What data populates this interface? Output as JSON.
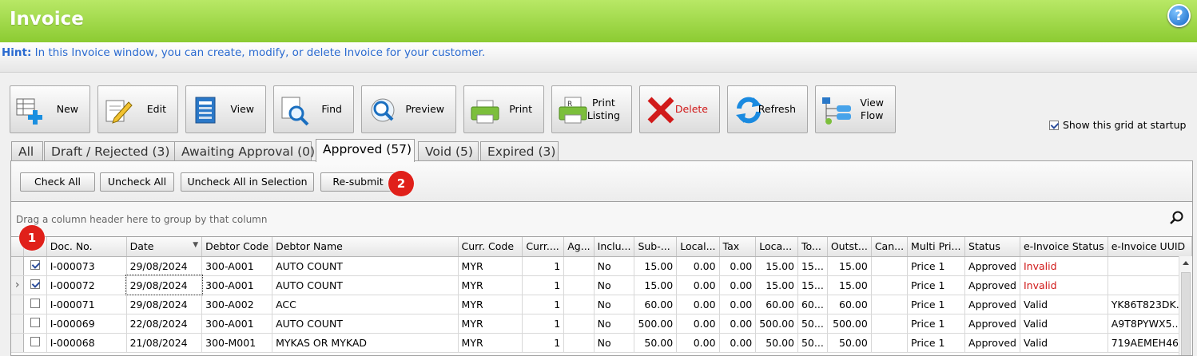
{
  "window": {
    "title": "Invoice",
    "help_label": "?"
  },
  "hint": {
    "label": "Hint:",
    "text": " In this Invoice window, you can create, modify, or delete Invoice for your customer."
  },
  "toolbar": {
    "new": "New",
    "edit": "Edit",
    "view": "View",
    "find": "Find",
    "preview": "Preview",
    "print": "Print",
    "print_listing": "Print\nListing",
    "delete": "Delete",
    "refresh": "Refresh",
    "view_flow": "View\nFlow"
  },
  "show_grid_startup": {
    "label": "Show this grid at startup",
    "checked": true
  },
  "tabs": [
    {
      "label": "All"
    },
    {
      "label": "Draft / Rejected (3)"
    },
    {
      "label": "Awaiting Approval (0)"
    },
    {
      "label": "Approved (57)",
      "active": true
    },
    {
      "label": "Void (5)"
    },
    {
      "label": "Expired (3)"
    }
  ],
  "actions": {
    "check_all": "Check All",
    "uncheck_all": "Uncheck All",
    "uncheck_selection": "Uncheck All in Selection",
    "resubmit": "Re-submit"
  },
  "badges": {
    "one": "1",
    "two": "2"
  },
  "group_hint": "Drag a column header here to group by that column",
  "columns": [
    "Doc. No.",
    "Date",
    "Debtor Code",
    "Debtor Name",
    "Curr. Code",
    "Curr....",
    "Ag...",
    "Inclu...",
    "Sub-...",
    "Local...",
    "Tax",
    "Loca...",
    "To...",
    "Outst...",
    "Can...",
    "Multi Pri...",
    "Status",
    "e-Invoice Status",
    "e-Invoice UUID"
  ],
  "rows": [
    [
      "I-000073",
      "29/08/2024",
      "300-A001",
      "AUTO COUNT",
      "MYR",
      "1",
      "",
      "No",
      "15.00",
      "0.00",
      "0.00",
      "15.00",
      "15...",
      "15.00",
      "",
      "Price 1",
      "Approved",
      "Invalid",
      ""
    ],
    [
      "I-000072",
      "29/08/2024",
      "300-A001",
      "AUTO COUNT",
      "MYR",
      "1",
      "",
      "No",
      "15.00",
      "0.00",
      "0.00",
      "15.00",
      "15...",
      "15.00",
      "",
      "Price 1",
      "Approved",
      "Invalid",
      ""
    ],
    [
      "I-000071",
      "29/08/2024",
      "300-A002",
      "ACC",
      "MYR",
      "1",
      "",
      "No",
      "60.00",
      "0.00",
      "0.00",
      "60.00",
      "60...",
      "60.00",
      "",
      "Price 1",
      "Approved",
      "Valid",
      "YK86T823DK..."
    ],
    [
      "I-000069",
      "22/08/2024",
      "300-A001",
      "AUTO COUNT",
      "MYR",
      "1",
      "",
      "No",
      "500.00",
      "0.00",
      "0.00",
      "500.00",
      "50...",
      "500.00",
      "",
      "Price 1",
      "Approved",
      "Valid",
      "A9T8PYWX5..."
    ],
    [
      "I-000068",
      "21/08/2024",
      "300-M001",
      "MYKAS OR MYKAD",
      "MYR",
      "1",
      "",
      "No",
      "50.00",
      "0.00",
      "0.00",
      "50.00",
      "50...",
      "50.00",
      "",
      "Price 1",
      "Approved",
      "Valid",
      "719AEMEH46..."
    ]
  ],
  "row_checked": [
    true,
    true,
    false,
    false,
    false
  ],
  "status_colors": {
    "invalid": "#d01818"
  }
}
